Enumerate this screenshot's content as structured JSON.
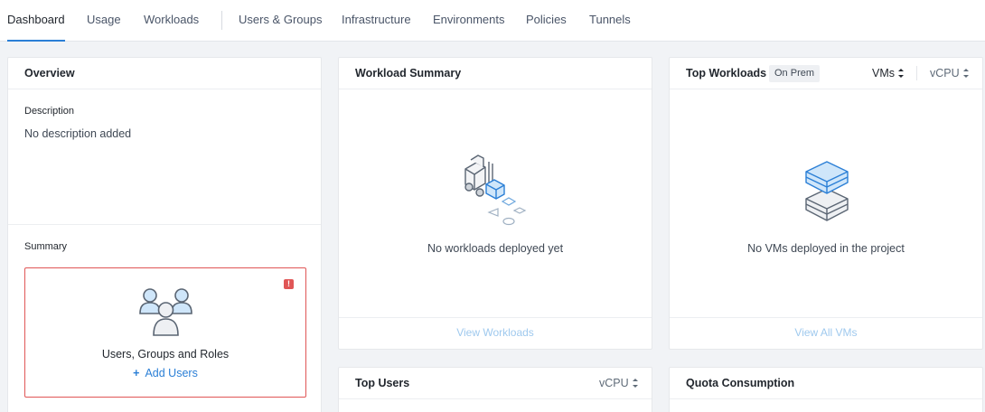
{
  "nav": {
    "tabs": [
      "Dashboard",
      "Usage",
      "Workloads",
      "Users & Groups",
      "Infrastructure",
      "Environments",
      "Policies",
      "Tunnels"
    ],
    "active": "Dashboard"
  },
  "overview": {
    "title": "Overview",
    "description_label": "Description",
    "description_value": "No description added",
    "summary_label": "Summary",
    "users_card_label": "Users, Groups and Roles",
    "add_users_label": "Add Users",
    "alert_symbol": "!"
  },
  "workload_summary": {
    "title": "Workload Summary",
    "empty_message": "No workloads deployed yet",
    "link": "View Workloads"
  },
  "top_workloads": {
    "title": "Top Workloads",
    "badge": "On Prem",
    "sort_primary": "VMs",
    "sort_secondary": "vCPU",
    "empty_message": "No VMs deployed in the project",
    "link": "View All VMs"
  },
  "top_users": {
    "title": "Top Users",
    "sort": "vCPU"
  },
  "quota": {
    "title": "Quota Consumption"
  },
  "colors": {
    "accent": "#2b7fd6",
    "alert": "#e05656",
    "link_faded": "#9fc9ee",
    "icon_blue": "#cfe6fa"
  }
}
